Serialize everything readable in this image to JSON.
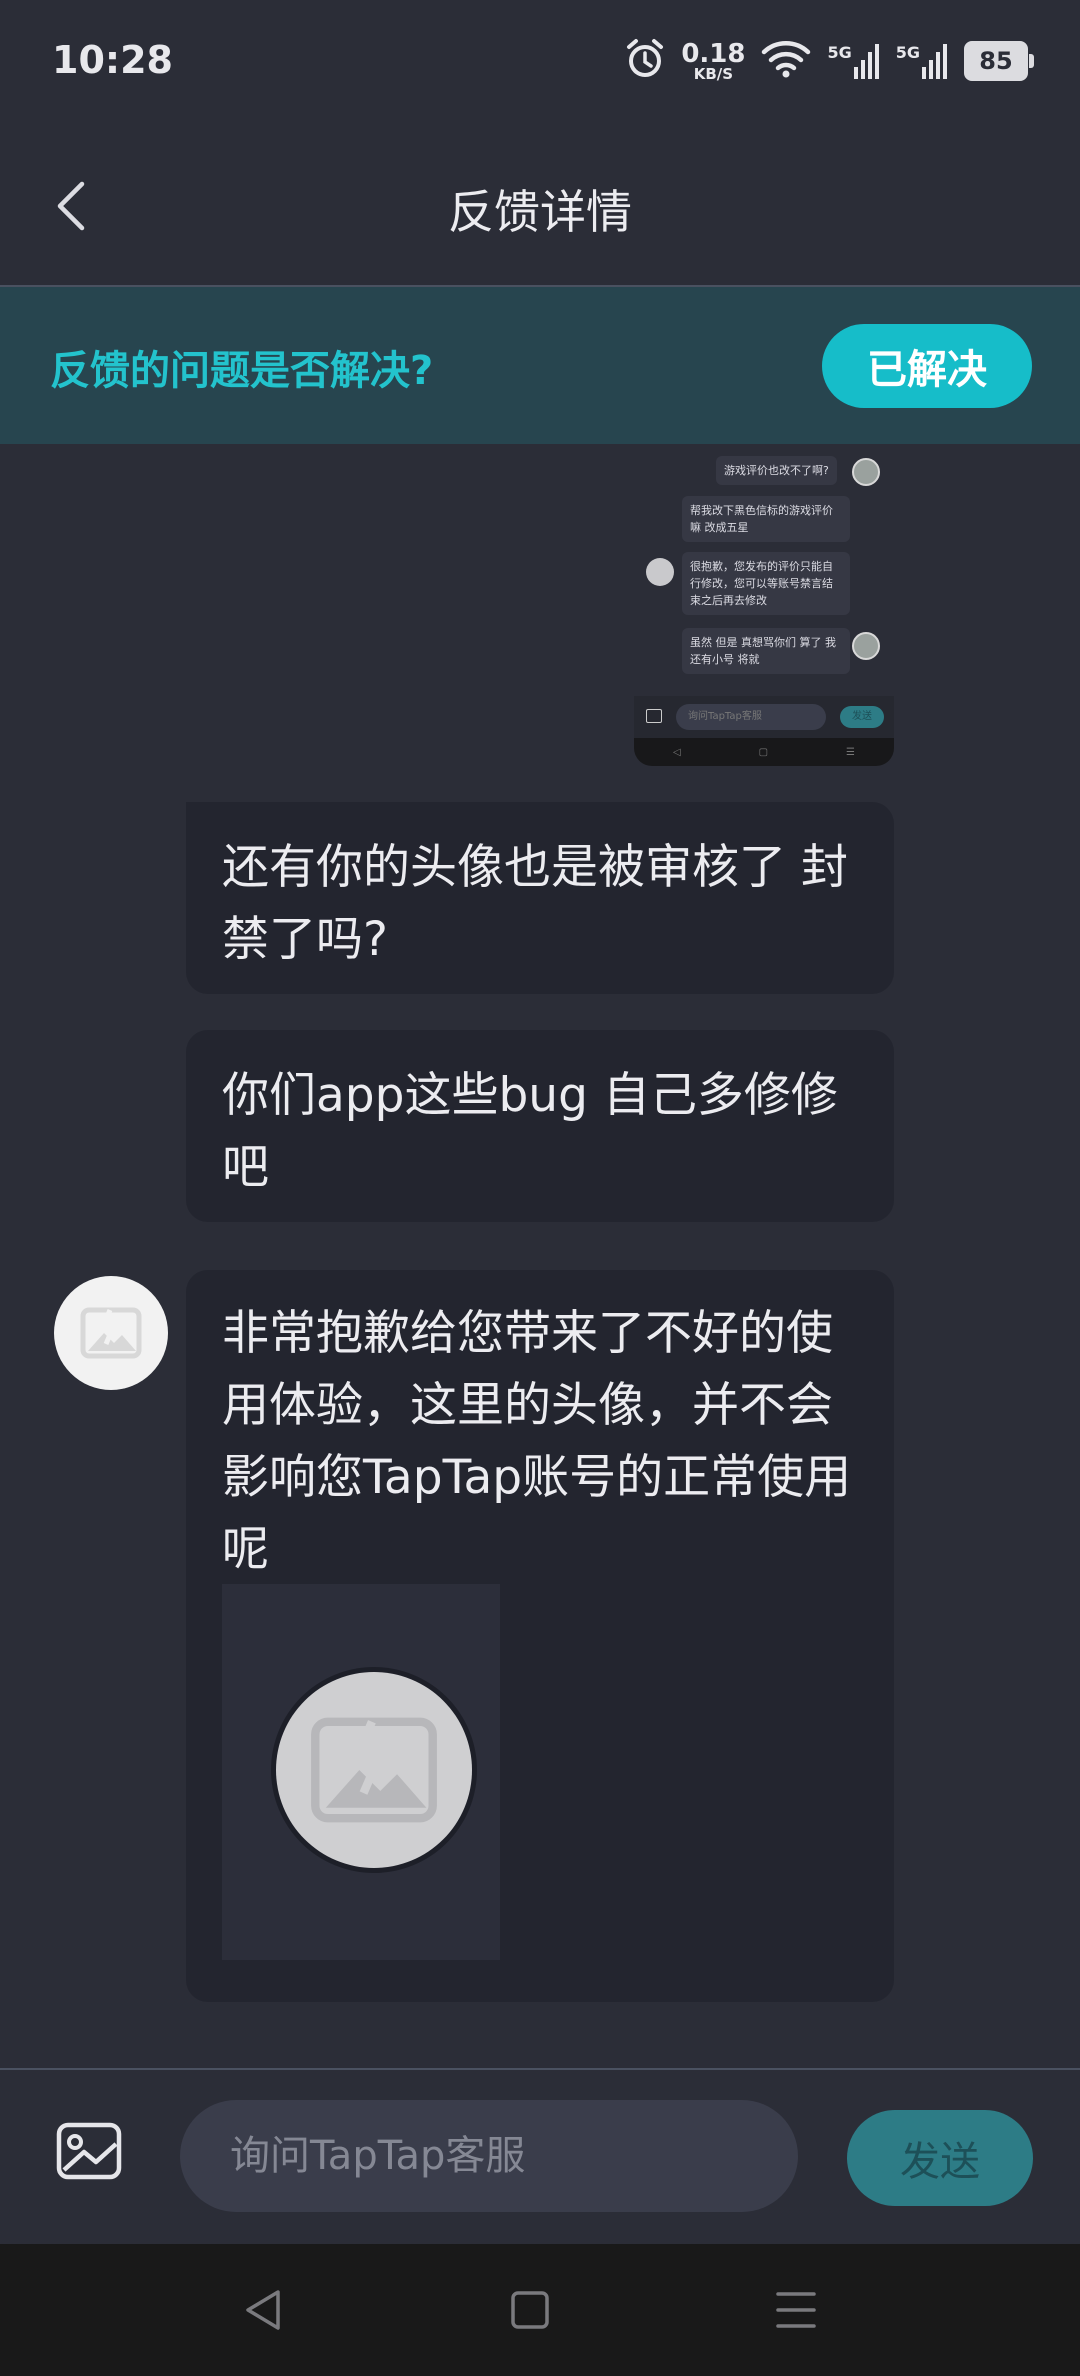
{
  "status_bar": {
    "time": "10:28",
    "net_speed_value": "0.18",
    "net_speed_unit": "KB/S",
    "signal_1_tag": "5G",
    "signal_2_tag": "5G",
    "battery": "85"
  },
  "header": {
    "title": "反馈详情",
    "back_icon": "chevron-left-icon"
  },
  "banner": {
    "question": "反馈的问题是否解决?",
    "resolved_label": "已解决"
  },
  "attached_screenshot": {
    "messages": [
      "游戏评价也改不了啊?",
      "帮我改下黑色信标的游戏评价 嘛 改成五星",
      "很抱歉，您发布的评价只能自 行修改，您可以等账号禁言结 束之后再去修改",
      "虽然 但是 真想骂你们 算了 我 还有小号 将就"
    ],
    "input_placeholder": "询问TapTap客服",
    "send_label": "发送"
  },
  "messages": [
    {
      "role": "user",
      "text": "还有你的头像也是被审核了 封禁了吗?"
    },
    {
      "role": "user",
      "text": "你们app这些bug 自己多修修吧"
    },
    {
      "role": "agent",
      "text": "非常抱歉给您带来了不好的使用体验，这里的头像，并不会影响您TapTap账号的正常使用呢"
    }
  ],
  "input_bar": {
    "placeholder": "询问TapTap客服",
    "send_label": "发送",
    "image_icon": "image-icon"
  },
  "nav_bar": {
    "back_icon": "triangle-back-icon",
    "home_icon": "square-home-icon",
    "menu_icon": "menu-lines-icon"
  },
  "colors": {
    "background": "#2b2d37",
    "accent": "#16bdc9",
    "banner_bg": "#27454f"
  }
}
